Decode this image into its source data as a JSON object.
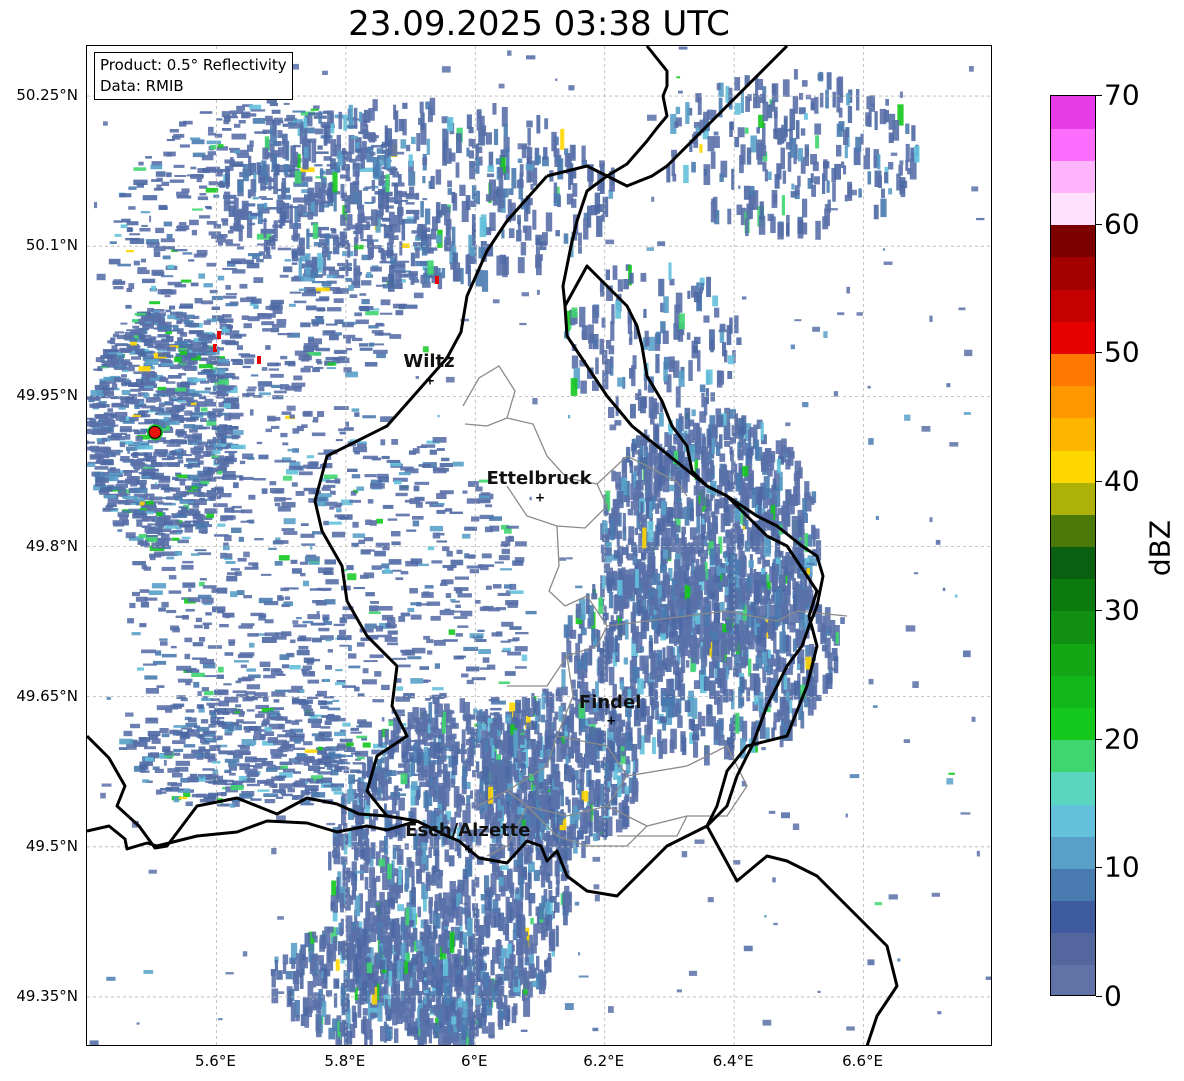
{
  "title": "23.09.2025 03:38 UTC",
  "info": {
    "product": "Product: 0.5° Reflectivity",
    "data_source": "Data: RMIB"
  },
  "lat_ticks": [
    "50.25°N",
    "50.1°N",
    "49.95°N",
    "49.8°N",
    "49.65°N",
    "49.5°N",
    "49.35°N"
  ],
  "lon_ticks": [
    "5.6°E",
    "5.8°E",
    "6°E",
    "6.2°E",
    "6.4°E",
    "6.6°E"
  ],
  "lat_values": [
    50.25,
    50.1,
    49.95,
    49.8,
    49.65,
    49.5,
    49.35
  ],
  "lon_values": [
    5.6,
    5.8,
    6.0,
    6.2,
    6.4,
    6.6
  ],
  "extent": {
    "lon_min": 5.4,
    "lon_max": 6.8,
    "lat_min": 49.3,
    "lat_max": 50.3
  },
  "cities": [
    {
      "name": "Wiltz",
      "lon": 5.93,
      "lat": 49.966
    },
    {
      "name": "Ettelbruck",
      "lon": 6.1,
      "lat": 49.849
    },
    {
      "name": "Findel",
      "lon": 6.21,
      "lat": 49.626
    },
    {
      "name": "Esch/Alzette",
      "lon": 5.99,
      "lat": 49.498
    }
  ],
  "radar_site": {
    "lon": 5.505,
    "lat": 49.914,
    "color": "#e8120e"
  },
  "colorbar": {
    "label": "dBZ",
    "min": 0,
    "max": 70,
    "tick_values": [
      0,
      10,
      20,
      30,
      40,
      50,
      60,
      70
    ],
    "tick_labels": [
      "0",
      "10",
      "20",
      "30",
      "40",
      "50",
      "60",
      "70"
    ],
    "colors": [
      "#6173a6",
      "#53679e",
      "#3e5ba0",
      "#4a7bb0",
      "#58a0c8",
      "#63c1dc",
      "#5ad6c0",
      "#3fd56f",
      "#14c81e",
      "#12b81a",
      "#13a615",
      "#118f12",
      "#0d7a0f",
      "#086010",
      "#4b7a09",
      "#adb108",
      "#fed600",
      "#fdb600",
      "#fe9700",
      "#fe7900",
      "#e60000",
      "#c50000",
      "#a30000",
      "#7d0000",
      "#ffe0fe",
      "#feb5fe",
      "#fd6dfe",
      "#e73be7"
    ]
  },
  "echo_colors": [
    "#5a70a8",
    "#4c68a4",
    "#4a7bb0",
    "#58a0c8",
    "#63c1dc",
    "#3fd56f",
    "#14c81e",
    "#ffd600",
    "#e60000"
  ]
}
